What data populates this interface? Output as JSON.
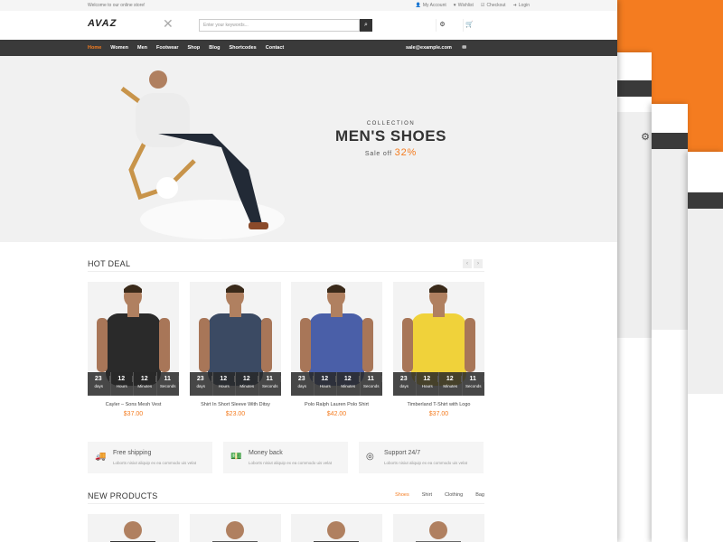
{
  "topbar": {
    "welcome": "Welcome to our online store!",
    "my_account": "My Account",
    "wishlist": "Wishlist",
    "checkout": "Checkout",
    "login": "Login"
  },
  "header": {
    "logo": "AVAZ",
    "search_placeholder": "Enter your keywords..."
  },
  "nav": {
    "items": [
      "Home",
      "Women",
      "Men",
      "Footwear",
      "Shop",
      "Blog",
      "Shortcodes",
      "Contact"
    ],
    "email": "sale@example.com"
  },
  "hero": {
    "collection": "COLLECTION",
    "title": "MEN'S SHOES",
    "sale_text": "Sale off",
    "sale_pct": "32%"
  },
  "hot_deal": {
    "title": "HOT DEAL",
    "products": [
      {
        "name": "Cayler – Sons Mesh Vest",
        "price": "$37.00",
        "shirt_color": "#2a2a2a",
        "countdown": [
          "23",
          "12",
          "12",
          "11"
        ]
      },
      {
        "name": "Shirt In Short Sleeve With Ditsy",
        "price": "$23.00",
        "shirt_color": "#3b4a63",
        "countdown": [
          "23",
          "12",
          "12",
          "11"
        ]
      },
      {
        "name": "Polo Ralph Lauren Polo Shirt",
        "price": "$42.00",
        "shirt_color": "#4a5fa8",
        "countdown": [
          "23",
          "12",
          "12",
          "11"
        ]
      },
      {
        "name": "Timberland T-Shirt with Logo",
        "price": "$37.00",
        "shirt_color": "#f0d23a",
        "countdown": [
          "23",
          "12",
          "12",
          "11"
        ]
      }
    ],
    "countdown_labels": [
      "days",
      "Hours",
      "Minutes",
      "Seconds"
    ]
  },
  "features": [
    {
      "icon": "truck-icon",
      "title": "Free shipping",
      "desc": "Loborts nisiut aliquip ex ea commodo uis velat"
    },
    {
      "icon": "money-icon",
      "title": "Money back",
      "desc": "Loborts nisiut aliquip ex ea commodo uis velat"
    },
    {
      "icon": "lifebuoy-icon",
      "title": "Support 24/7",
      "desc": "Loborts nisiut aliquip ex ea commodo uis velat"
    }
  ],
  "new_products": {
    "title": "NEW PRODUCTS",
    "tabs": [
      "Shoes",
      "Shirt",
      "Clothing",
      "Bag"
    ]
  },
  "colors": {
    "accent": "#f47c20",
    "nav_bg": "#3a3a3a"
  }
}
